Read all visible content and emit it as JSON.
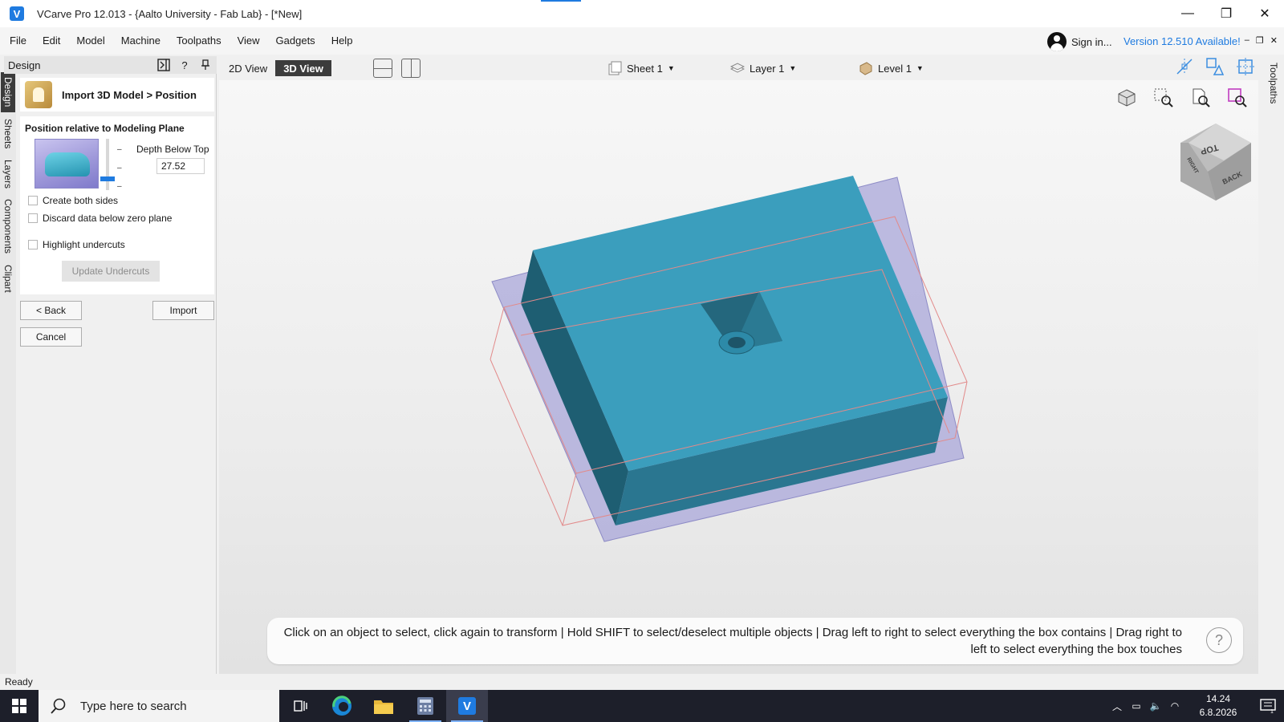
{
  "window": {
    "title": "VCarve Pro 12.013 - {Aalto University - Fab Lab} - [*New]",
    "app_icon": "vcarve-app-icon",
    "controls": {
      "minimize": "—",
      "restore": "❐",
      "close": "✕"
    }
  },
  "menubar": {
    "items": [
      "File",
      "Edit",
      "Model",
      "Machine",
      "Toolpaths",
      "View",
      "Gadgets",
      "Help"
    ],
    "signin_label": "Sign in...",
    "version_notice": "Version 12.510 Available!",
    "accent_color": "#1f7be0"
  },
  "left_tabs": [
    "Design",
    "Sheets",
    "Layers",
    "Components",
    "Clipart"
  ],
  "panel": {
    "header_label": "Design",
    "header_icons": [
      "collapse-panel-icon",
      "help-icon",
      "pin-icon"
    ],
    "import_title": "Import 3D Model > Position",
    "position_title": "Position relative to Modeling Plane",
    "depth_label": "Depth Below Top",
    "depth_value": "27.52",
    "checkboxes": {
      "create_both_sides": {
        "label": "Create both sides",
        "checked": false
      },
      "discard_below_zero": {
        "label": "Discard data below zero plane",
        "checked": false
      },
      "highlight_undercuts": {
        "label": "Highlight undercuts",
        "checked": false
      }
    },
    "update_undercuts_label": "Update Undercuts",
    "back_label": "< Back",
    "import_label": "Import",
    "cancel_label": "Cancel"
  },
  "viewbar": {
    "view_2d": "2D View",
    "view_3d": "3D View",
    "sheet": "Sheet 1",
    "layer": "Layer 1",
    "level": "Level 1"
  },
  "right_tab": "Toolpaths",
  "navcube": {
    "top": "TOP",
    "right": "RIGHT",
    "back": "BACK"
  },
  "hint": {
    "text": "Click on an object to select, click again to transform | Hold SHIFT to select/deselect multiple objects | Drag left to right to select everything the box contains | Drag right to left to select everything the box touches",
    "help": "?"
  },
  "status": {
    "text": "Ready"
  },
  "taskbar": {
    "search_placeholder": "Type here to search",
    "time": "14.24",
    "date": "6.8.2026",
    "notification_count": "1"
  },
  "colors": {
    "model": "#3b9ebd",
    "model_dark": "#1e5e72",
    "plane": "#a9a7d9",
    "bbox": "#e28a8a"
  }
}
